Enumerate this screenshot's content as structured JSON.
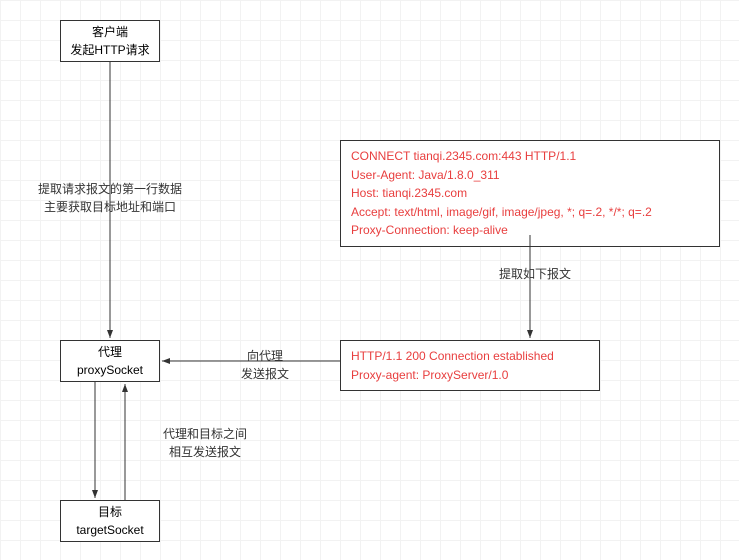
{
  "nodes": {
    "client": {
      "line1": "客户端",
      "line2": "发起HTTP请求"
    },
    "proxy": {
      "line1": "代理",
      "line2": "proxySocket"
    },
    "target": {
      "line1": "目标",
      "line2": "targetSocket"
    }
  },
  "boxes": {
    "request": {
      "l1": "CONNECT tianqi.2345.com:443 HTTP/1.1",
      "l2": "User-Agent: Java/1.8.0_311",
      "l3": "Host: tianqi.2345.com",
      "l4": "Accept: text/html, image/gif, image/jpeg, *; q=.2, */*; q=.2",
      "l5": "Proxy-Connection: keep-alive"
    },
    "response": {
      "l1": "HTTP/1.1 200 Connection established",
      "l2": "Proxy-agent: ProxyServer/1.0"
    }
  },
  "edgeLabels": {
    "extractFirstLine": {
      "l1": "提取请求报文的第一行数据",
      "l2": "主要获取目标地址和端口"
    },
    "extractBelow": "提取如下报文",
    "sendToProxy": {
      "l1": "向代理",
      "l2": "发送报文"
    },
    "proxyTarget": {
      "l1": "代理和目标之间",
      "l2": "相互发送报文"
    }
  }
}
